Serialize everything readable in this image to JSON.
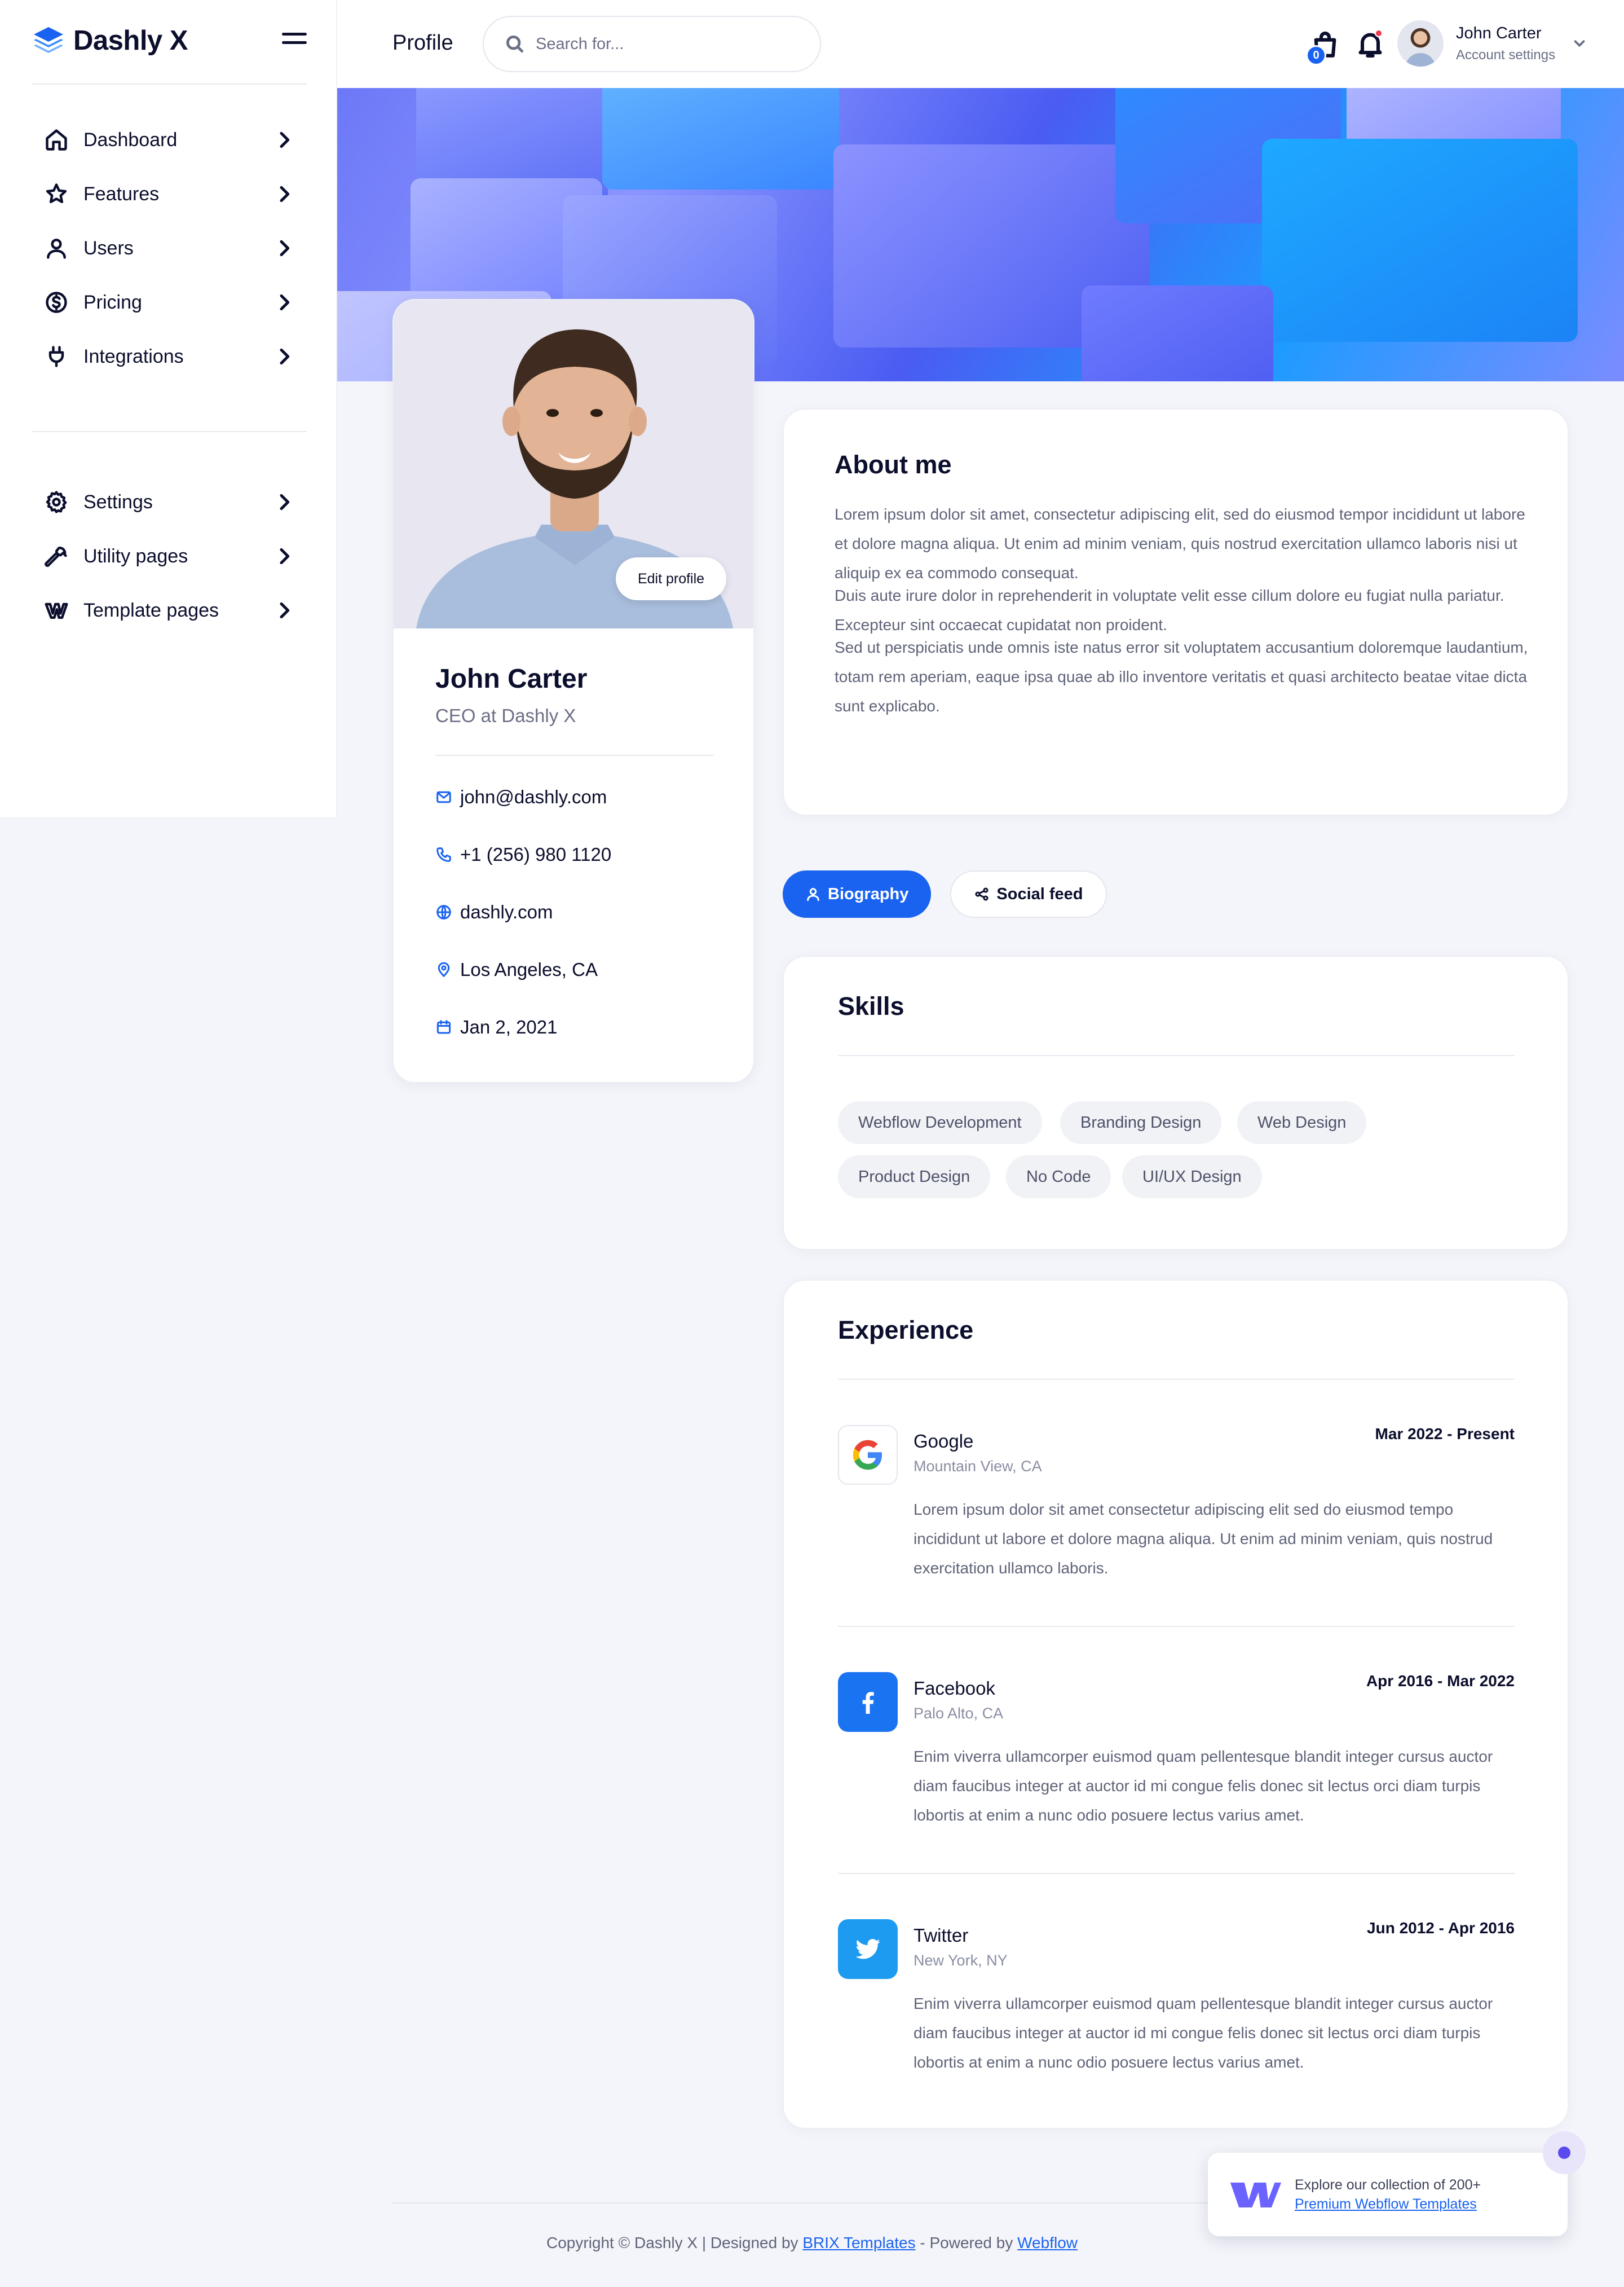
{
  "brand": {
    "name": "Dashly X",
    "accent": "#1a63f0"
  },
  "sidebar": {
    "main_items": [
      {
        "label": "Dashboard",
        "icon": "home-icon"
      },
      {
        "label": "Features",
        "icon": "star-icon"
      },
      {
        "label": "Users",
        "icon": "user-icon"
      },
      {
        "label": "Pricing",
        "icon": "dollar-circle-icon"
      },
      {
        "label": "Integrations",
        "icon": "plug-icon"
      }
    ],
    "secondary_items": [
      {
        "label": "Settings",
        "icon": "gear-icon"
      },
      {
        "label": "Utility pages",
        "icon": "wrench-icon"
      },
      {
        "label": "Template pages",
        "icon": "webflow-icon"
      }
    ]
  },
  "header": {
    "page_title": "Profile",
    "search_placeholder": "Search for...",
    "cart_count": "0",
    "user_name": "John Carter",
    "user_sub": "Account settings"
  },
  "profile": {
    "edit_label": "Edit profile",
    "name": "John Carter",
    "role": "CEO at Dashly X",
    "email": "john@dashly.com",
    "phone": "+1 (256) 980 1120",
    "website": "dashly.com",
    "location": "Los Angeles, CA",
    "joined": "Jan 2, 2021"
  },
  "about": {
    "title": "About me",
    "paragraphs": [
      "Lorem ipsum dolor sit amet, consectetur adipiscing elit, sed do eiusmod tempor incididunt ut labore et dolore magna aliqua. Ut enim ad minim veniam, quis nostrud exercitation ullamco laboris nisi ut aliquip ex ea commodo consequat.",
      "Duis aute irure dolor in reprehenderit in voluptate velit esse cillum dolore eu fugiat nulla pariatur. Excepteur sint occaecat cupidatat non proident.",
      "Sed ut perspiciatis unde omnis iste natus error sit voluptatem accusantium doloremque laudantium, totam rem aperiam, eaque ipsa quae ab illo inventore veritatis et quasi architecto beatae vitae dicta sunt explicabo."
    ]
  },
  "tabs": [
    {
      "label": "Biography",
      "active": true
    },
    {
      "label": "Social feed",
      "active": false
    }
  ],
  "skills": {
    "title": "Skills",
    "items": [
      "Webflow Development",
      "Branding Design",
      "Web Design",
      "Product Design",
      "No Code",
      "UI/UX Design"
    ]
  },
  "experience": {
    "title": "Experience",
    "items": [
      {
        "company": "Google",
        "location": "Mountain View, CA",
        "dates": "Mar 2022 - Present",
        "description": "Lorem ipsum dolor sit amet consectetur adipiscing elit sed do eiusmod tempo incididunt ut labore et dolore magna aliqua. Ut enim ad minim veniam, quis nostrud exercitation ullamco laboris.",
        "logo": "google-logo-icon"
      },
      {
        "company": "Facebook",
        "location": "Palo Alto, CA",
        "dates": "Apr 2016 - Mar 2022",
        "description": "Enim viverra ullamcorper euismod quam pellentesque blandit integer cursus auctor diam faucibus integer at auctor id mi congue felis donec sit lectus orci diam turpis lobortis at enim a nunc odio posuere lectus varius amet.",
        "logo": "facebook-logo-icon"
      },
      {
        "company": "Twitter",
        "location": "New York, NY",
        "dates": "Jun 2012 - Apr 2016",
        "description": "Enim viverra ullamcorper euismod quam pellentesque blandit integer cursus auctor diam faucibus integer at auctor id mi congue felis donec sit lectus orci diam turpis lobortis at enim a nunc odio posuere lectus varius amet.",
        "logo": "twitter-logo-icon"
      }
    ]
  },
  "footer": {
    "prefix": "Copyright © Dashly X | Designed by ",
    "brix": "BRIX Templates",
    "middle": " - Powered by ",
    "webflow": "Webflow"
  },
  "promo": {
    "line1": "Explore our collection of 200+",
    "link": "Premium Webflow Templates"
  }
}
